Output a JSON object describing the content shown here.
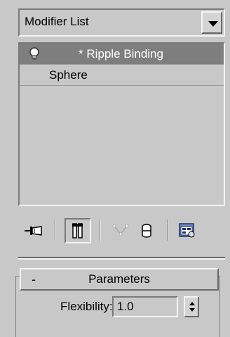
{
  "modifier_list": {
    "value": "Modifier List"
  },
  "stack": {
    "items": [
      {
        "label": "* Ripple Binding",
        "selected": true,
        "icon": "lightbulb-icon"
      },
      {
        "label": "Sphere",
        "selected": false
      }
    ]
  },
  "toolbar": {
    "icons": [
      "pin-stack-icon",
      "show-end-result-icon",
      "make-unique-icon",
      "remove-modifier-icon",
      "configure-modifier-sets-icon"
    ]
  },
  "parameters": {
    "collapse_symbol": "-",
    "title": "Parameters",
    "flexibility_label": "Flexibility:",
    "flexibility_value": "1.0"
  },
  "colors": {
    "panel_bg": "#c8c8c8",
    "selected_row": "#7e7e7e"
  }
}
